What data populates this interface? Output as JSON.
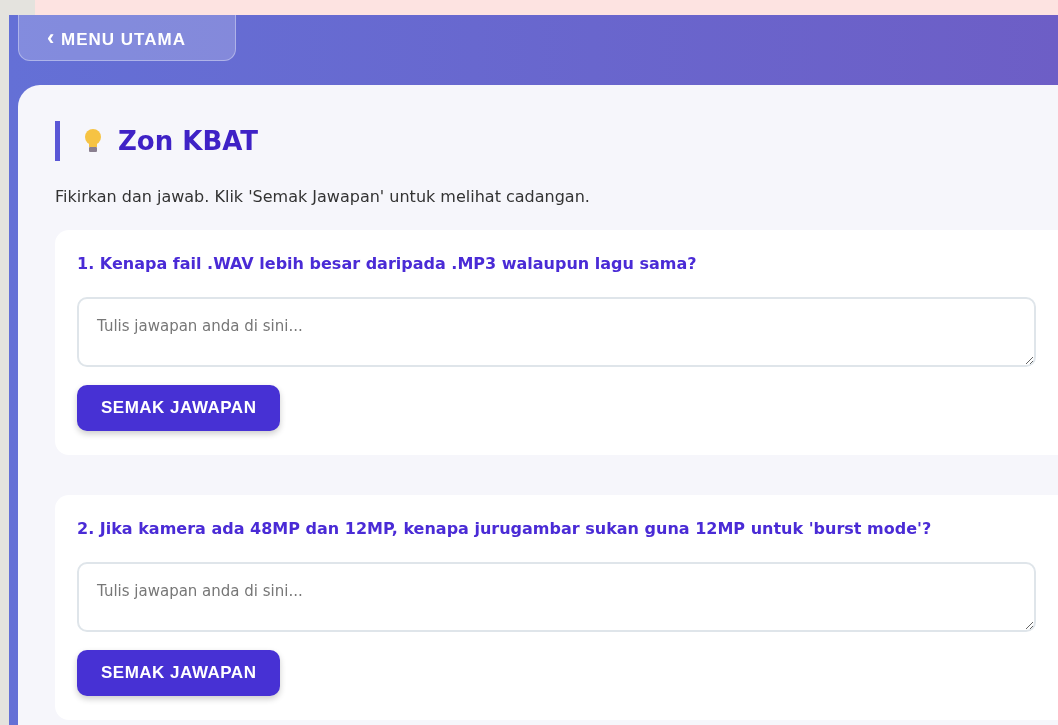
{
  "back_button": {
    "icon": "‹",
    "label": "MENU UTAMA"
  },
  "section": {
    "title": "Zon KBAT",
    "instructions": "Fikirkan dan jawab. Klik 'Semak Jawapan' untuk melihat cadangan."
  },
  "questions": [
    {
      "text": "1. Kenapa fail .WAV lebih besar daripada .MP3 walaupun lagu sama?",
      "placeholder": "Tulis jawapan anda di sini...",
      "button": "SEMAK JAWAPAN"
    },
    {
      "text": "2. Jika kamera ada 48MP dan 12MP, kenapa jurugambar sukan guna 12MP untuk 'burst mode'?",
      "placeholder": "Tulis jawapan anda di sini...",
      "button": "SEMAK JAWAPAN"
    }
  ]
}
